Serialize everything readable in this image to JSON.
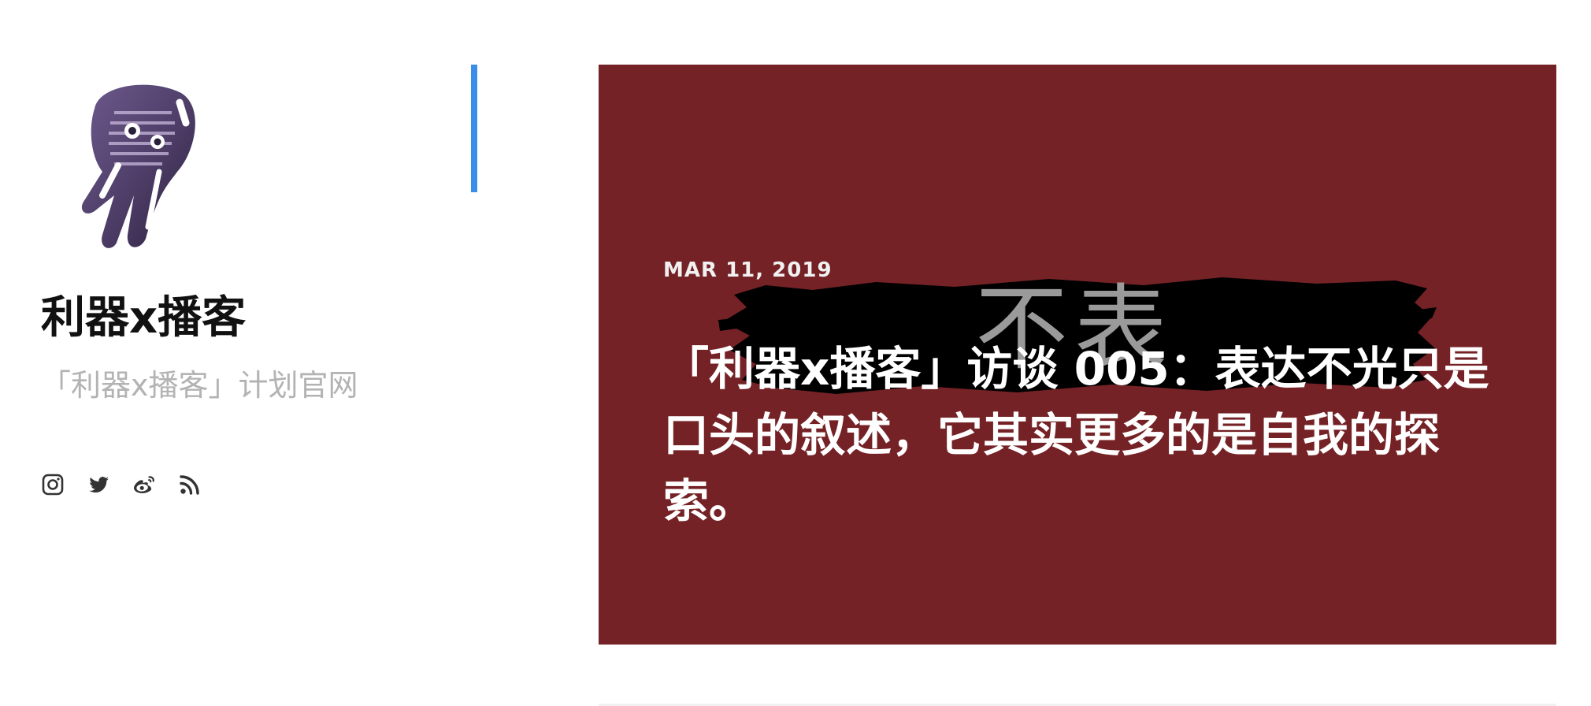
{
  "site": {
    "title": "利器x播客",
    "description": "「利器x播客」计划官网",
    "logo_icon": "microphone-logo-icon",
    "social_icons": [
      "instagram-icon",
      "twitter-icon",
      "weibo-icon",
      "rss-icon"
    ]
  },
  "post": {
    "date": "MAR 11, 2019",
    "title": "「利器x播客」访谈 005：表达不光只是口头的叙述，它其实更多的是自我的探索。",
    "cover_text": "不表"
  },
  "colors": {
    "card_background": "#742226",
    "accent": "#3a8de8",
    "description_text": "#b3b3b3"
  }
}
